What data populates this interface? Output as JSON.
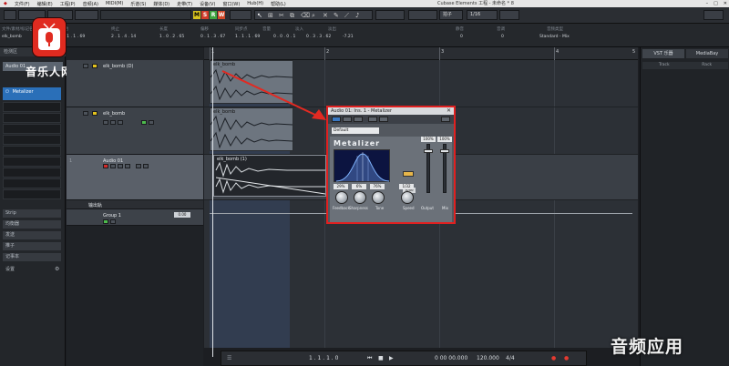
{
  "menubar": {
    "items": [
      "文件(F)",
      "编辑(E)",
      "工程(P)",
      "音频(A)",
      "MIDI(M)",
      "乐谱(S)",
      "媒体(D)",
      "走带(T)",
      "设备(V)",
      "窗口(W)",
      "Hub(H)",
      "帮助(L)"
    ],
    "window_title": "Cubase Elements 工程 - 未命名 * 8"
  },
  "toolbar": {
    "mode_buttons": [
      "M",
      "S",
      "R",
      "W"
    ],
    "snap_value": "1/16",
    "snap_mode": "拍子"
  },
  "infoline": {
    "headers": [
      "文件/素材/标记名称",
      "起始",
      "终止",
      "长度",
      "偏移",
      "已锁定",
      "同步点",
      "音量",
      "淡入",
      "淡出",
      "静音",
      "音调",
      "淡出",
      "节拍",
      "音频类型",
      "乐器"
    ],
    "values": [
      "elk_bomb",
      "1 . 1 . 1 . 69",
      "2 . 1 . 4 . 14",
      "1 . 0 . 2 . 65",
      "0 . 1 . 3 . 67",
      "1 . 1 . 1 . 69",
      "0 . 0 . 0 . 1",
      "0 . 3 . 3 . 62",
      "-7.21",
      "0",
      "0",
      "Standard - Mix"
    ]
  },
  "inspector": {
    "header": "检测区",
    "channel_label": "Audio 01",
    "insert_plugin": "Metalizer",
    "sections": [
      "Strip",
      "均衡器",
      "发送",
      "推子",
      "记事本",
      "设置"
    ]
  },
  "logo": {
    "text": "音乐人网"
  },
  "tracks": [
    {
      "name": "elk_bomb (D)"
    },
    {
      "name": "elk_bomb"
    },
    {
      "name": "Audio 01"
    },
    {
      "name": "输出轨"
    },
    {
      "name": "Group 1",
      "value": "0.00"
    }
  ],
  "ruler": {
    "ticks": [
      "1",
      "2",
      "3",
      "4",
      "5"
    ]
  },
  "parts": [
    {
      "title": "elk_bomb"
    },
    {
      "title": "elk_bomb"
    },
    {
      "title": "elk_bomb (1)"
    }
  ],
  "rightpanel": {
    "tabs": [
      "VST 乐器",
      "MediaBay"
    ],
    "sub": [
      "Track",
      "Rack"
    ]
  },
  "plugin": {
    "title": "Audio 01: Ins. 1 - Metalizer",
    "preset": "Default",
    "name": "Metalizer",
    "tone_label": "Tone",
    "knobs": [
      {
        "label": "Feedback",
        "value": "29%"
      },
      {
        "label": "Sharpness",
        "value": "6%"
      },
      {
        "label": "Tone",
        "value": "76%"
      }
    ],
    "speed": {
      "label": "Speed",
      "value": "1/32"
    },
    "output": {
      "label": "Output",
      "value": "100%"
    },
    "mix": {
      "label": "Mix",
      "value": "100%"
    }
  },
  "transport": {
    "position": "1 . 1 . 1 . 0",
    "time": "0 00 00.000",
    "tempo": "120.000",
    "signature": "4/4"
  },
  "watermark": {
    "text": "音频应用"
  }
}
